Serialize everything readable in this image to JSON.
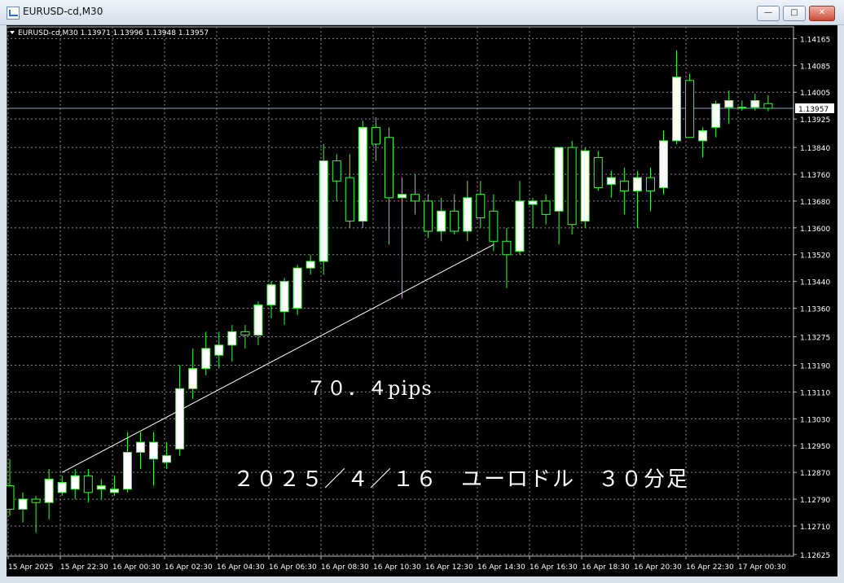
{
  "window": {
    "title": "EURUSD-cd,M30",
    "buttons": [
      "minimize-icon",
      "maximize-icon",
      "close-icon"
    ]
  },
  "chart_data": {
    "type": "candlestick",
    "header": "EURUSD-cd,M30  1.13971 1.13996 1.13948 1.13957",
    "current_price_label": "1.13957",
    "current_price": 1.13957,
    "ylim": [
      1.1262,
      1.142
    ],
    "grid": true,
    "colors": {
      "background": "#000000",
      "grid": "#8a8a8a",
      "bull": "#ffffff",
      "bear": "#000000",
      "wick": "#33ff33",
      "axis_text": "#ffffff",
      "price_line": "#8fa3b8"
    },
    "y_ticks": [
      "1.14165",
      "1.14085",
      "1.14005",
      "1.13925",
      "1.13840",
      "1.13760",
      "1.13680",
      "1.13600",
      "1.13520",
      "1.13440",
      "1.13360",
      "1.13275",
      "1.13190",
      "1.13110",
      "1.13030",
      "1.12950",
      "1.12870",
      "1.12790",
      "1.12710",
      "1.12625"
    ],
    "x_ticks": [
      "15 Apr 2025",
      "15 Apr 22:30",
      "16 Apr 00:30",
      "16 Apr 02:30",
      "16 Apr 04:30",
      "16 Apr 06:30",
      "16 Apr 08:30",
      "16 Apr 10:30",
      "16 Apr 12:30",
      "16 Apr 14:30",
      "16 Apr 16:30",
      "16 Apr 18:30",
      "16 Apr 20:30",
      "16 Apr 22:30",
      "17 Apr 00:30"
    ],
    "candles": [
      [
        1.1283,
        1.1291,
        1.1274,
        1.1276
      ],
      [
        1.1276,
        1.1281,
        1.1272,
        1.1279
      ],
      [
        1.1279,
        1.128,
        1.1269,
        1.1278
      ],
      [
        1.1278,
        1.1288,
        1.1273,
        1.1285
      ],
      [
        1.1281,
        1.1286,
        1.128,
        1.1284
      ],
      [
        1.1282,
        1.1288,
        1.1279,
        1.1286
      ],
      [
        1.1286,
        1.1288,
        1.1278,
        1.1281
      ],
      [
        1.1282,
        1.1285,
        1.1279,
        1.1283
      ],
      [
        1.1281,
        1.1286,
        1.128,
        1.1282
      ],
      [
        1.1282,
        1.1299,
        1.1281,
        1.1293
      ],
      [
        1.1293,
        1.1299,
        1.1288,
        1.1296
      ],
      [
        1.1291,
        1.1299,
        1.1283,
        1.1296
      ],
      [
        1.129,
        1.1296,
        1.1288,
        1.1292
      ],
      [
        1.1294,
        1.1319,
        1.1292,
        1.1312
      ],
      [
        1.1312,
        1.1324,
        1.1309,
        1.1318
      ],
      [
        1.1318,
        1.1329,
        1.1316,
        1.1324
      ],
      [
        1.1322,
        1.1329,
        1.1318,
        1.1325
      ],
      [
        1.1325,
        1.1331,
        1.132,
        1.1329
      ],
      [
        1.1329,
        1.1331,
        1.1324,
        1.1328
      ],
      [
        1.1328,
        1.1338,
        1.1325,
        1.1337
      ],
      [
        1.1337,
        1.1344,
        1.1333,
        1.1343
      ],
      [
        1.1335,
        1.1345,
        1.1331,
        1.1344
      ],
      [
        1.1336,
        1.1349,
        1.1334,
        1.1348
      ],
      [
        1.1348,
        1.1352,
        1.1346,
        1.135
      ],
      [
        1.135,
        1.1385,
        1.1346,
        1.138
      ],
      [
        1.138,
        1.1382,
        1.1368,
        1.1374
      ],
      [
        1.1375,
        1.1382,
        1.136,
        1.1362
      ],
      [
        1.1362,
        1.1392,
        1.136,
        1.139
      ],
      [
        1.139,
        1.1393,
        1.138,
        1.1385
      ],
      [
        1.1387,
        1.139,
        1.1355,
        1.1369
      ],
      [
        1.1369,
        1.1375,
        1.1339,
        1.137
      ],
      [
        1.137,
        1.1376,
        1.1364,
        1.1368
      ],
      [
        1.1368,
        1.137,
        1.1357,
        1.1359
      ],
      [
        1.1359,
        1.1369,
        1.1356,
        1.1365
      ],
      [
        1.1365,
        1.137,
        1.1358,
        1.1359
      ],
      [
        1.1359,
        1.1374,
        1.1356,
        1.1369
      ],
      [
        1.137,
        1.1374,
        1.136,
        1.1363
      ],
      [
        1.1365,
        1.137,
        1.1353,
        1.1356
      ],
      [
        1.1356,
        1.136,
        1.1342,
        1.1352
      ],
      [
        1.1353,
        1.1374,
        1.1352,
        1.1368
      ],
      [
        1.1367,
        1.1369,
        1.136,
        1.1368
      ],
      [
        1.1368,
        1.137,
        1.1361,
        1.1364
      ],
      [
        1.1365,
        1.1384,
        1.1355,
        1.1384
      ],
      [
        1.1384,
        1.1386,
        1.1358,
        1.1361
      ],
      [
        1.1362,
        1.1384,
        1.136,
        1.1383
      ],
      [
        1.1381,
        1.1383,
        1.1371,
        1.1372
      ],
      [
        1.1373,
        1.1377,
        1.1369,
        1.1375
      ],
      [
        1.1374,
        1.1378,
        1.1364,
        1.1371
      ],
      [
        1.1371,
        1.1377,
        1.136,
        1.1375
      ],
      [
        1.1375,
        1.1378,
        1.1365,
        1.1371
      ],
      [
        1.1372,
        1.1389,
        1.137,
        1.1386
      ],
      [
        1.1386,
        1.1413,
        1.1385,
        1.1405
      ],
      [
        1.1404,
        1.1406,
        1.1388,
        1.1387
      ],
      [
        1.1386,
        1.139,
        1.1381,
        1.1389
      ],
      [
        1.139,
        1.1398,
        1.1387,
        1.1397
      ],
      [
        1.1396,
        1.1401,
        1.1391,
        1.1398
      ],
      [
        1.1396,
        1.1398,
        1.1395,
        1.1396
      ],
      [
        1.1396,
        1.14,
        1.1395,
        1.1398
      ],
      [
        1.13971,
        1.13996,
        1.13948,
        1.13957
      ]
    ],
    "annotations": [
      {
        "type": "trendline",
        "from_candle": 4,
        "from_price": 1.1287,
        "to_candle": 37,
        "to_price": 1.1355
      },
      {
        "type": "text",
        "text": "７０．４pips"
      },
      {
        "type": "text",
        "text": "２０２５／４／１６　ユーロドル　３０分足"
      }
    ]
  }
}
